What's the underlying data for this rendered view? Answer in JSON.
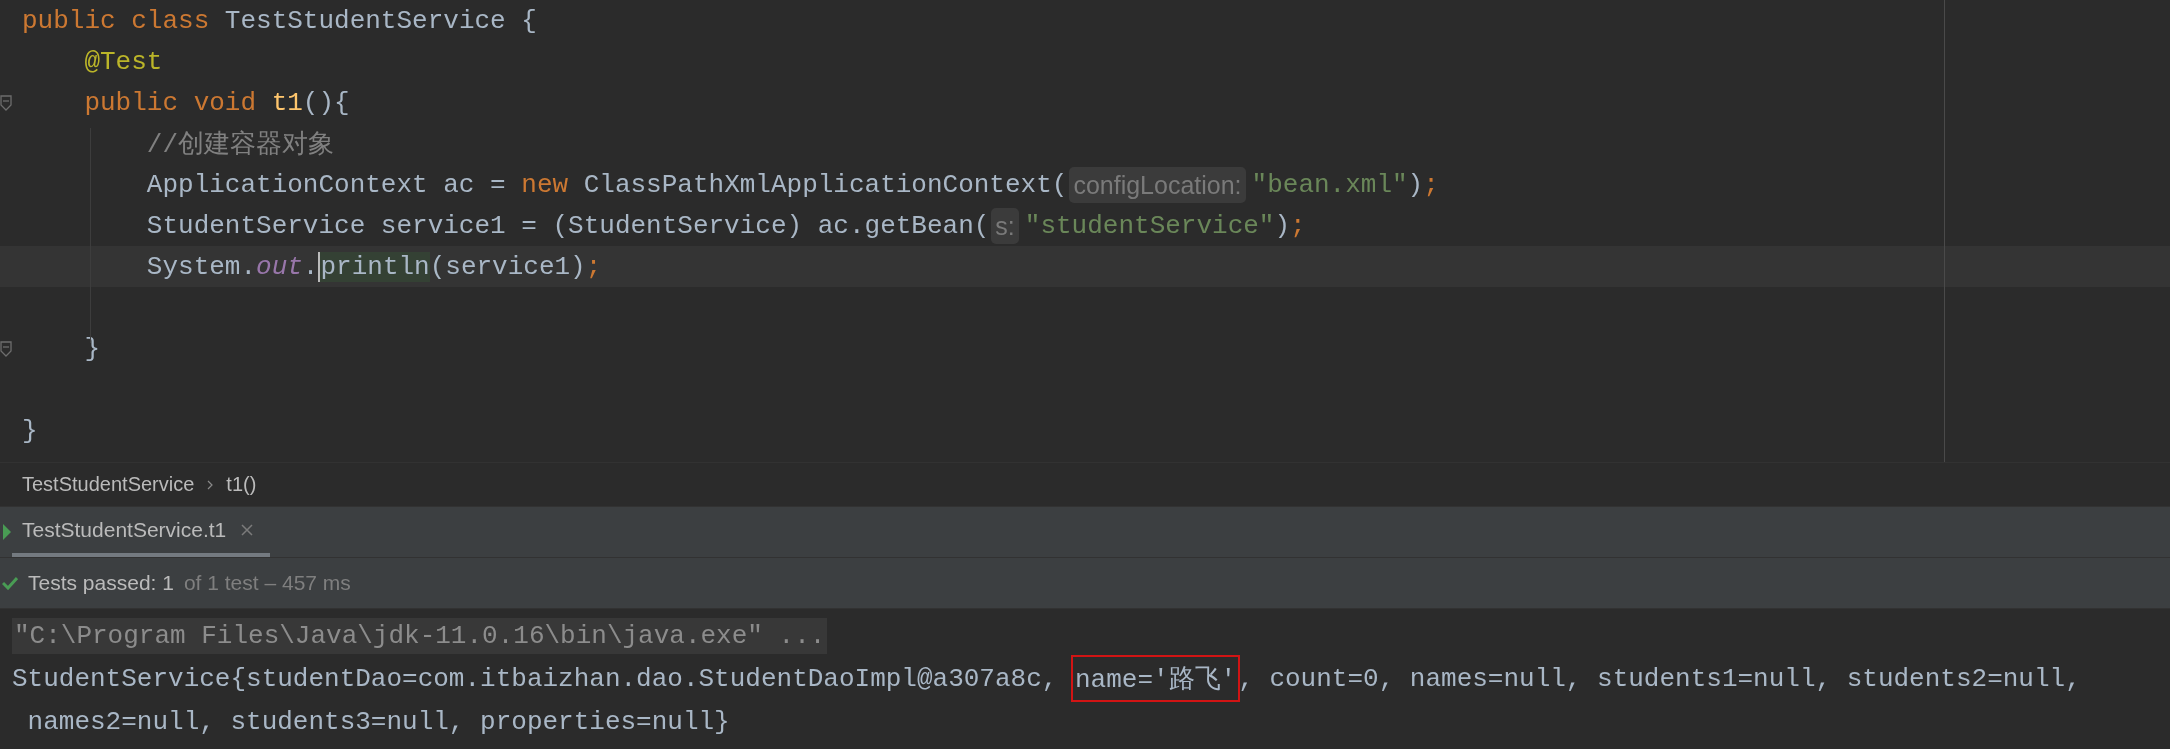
{
  "editor": {
    "lines": [
      {
        "kind": "code",
        "tokens": [
          {
            "kind": "keyword",
            "text": "public class "
          },
          {
            "kind": "plain",
            "text": "TestStudentService {"
          }
        ]
      },
      {
        "kind": "code",
        "tokens": [
          {
            "kind": "annotation",
            "text": "    @Test"
          }
        ]
      },
      {
        "kind": "code",
        "fold": true,
        "tokens": [
          {
            "kind": "keyword",
            "text": "    public void "
          },
          {
            "kind": "method",
            "text": "t1"
          },
          {
            "kind": "plain",
            "text": "(){"
          }
        ]
      },
      {
        "kind": "code",
        "tokens": [
          {
            "kind": "comment",
            "text": "        //创建容器对象"
          }
        ]
      },
      {
        "kind": "code",
        "tokens": [
          {
            "kind": "plain",
            "text": "        ApplicationContext ac = "
          },
          {
            "kind": "keyword",
            "text": "new "
          },
          {
            "kind": "plain",
            "text": "ClassPathXmlApplicationContext("
          },
          {
            "kind": "hint",
            "text": "configLocation:"
          },
          {
            "kind": "string",
            "text": "\"bean.xml\""
          },
          {
            "kind": "plain",
            "text": ")"
          },
          {
            "kind": "keyword",
            "text": ";"
          }
        ]
      },
      {
        "kind": "code",
        "tokens": [
          {
            "kind": "plain",
            "text": "        StudentService service1 = (StudentService) ac.getBean("
          },
          {
            "kind": "hint",
            "text": "s:"
          },
          {
            "kind": "string",
            "text": "\"studentService\""
          },
          {
            "kind": "plain",
            "text": ")"
          },
          {
            "kind": "keyword",
            "text": ";"
          }
        ]
      },
      {
        "kind": "code",
        "current": true,
        "tokens": [
          {
            "kind": "plain",
            "text": "        System."
          },
          {
            "kind": "static",
            "text": "out"
          },
          {
            "kind": "plain",
            "text": "."
          },
          {
            "kind": "usage",
            "text": "println"
          },
          {
            "kind": "plain",
            "text": "(service1)"
          },
          {
            "kind": "keyword",
            "text": ";"
          }
        ]
      },
      {
        "kind": "blank"
      },
      {
        "kind": "code",
        "fold": true,
        "tokens": [
          {
            "kind": "plain",
            "text": "    }"
          }
        ]
      },
      {
        "kind": "blank"
      },
      {
        "kind": "code",
        "tokens": [
          {
            "kind": "plain",
            "text": "}"
          }
        ]
      }
    ]
  },
  "breadcrumbs": [
    "TestStudentService",
    "t1()"
  ],
  "run_tab": {
    "label": "TestStudentService.t1",
    "selected": true
  },
  "test_status": {
    "summary": "Tests passed: 1",
    "detail": "of 1 test – 457 ms"
  },
  "console": {
    "lines": [
      {
        "kind": "command",
        "segments": [
          {
            "text": "\"C:\\Program Files\\Java\\jdk-11.0.16\\bin\\java.exe\" ...",
            "boxed": false
          }
        ]
      },
      {
        "kind": "output",
        "segments": [
          {
            "text": "StudentService{studentDao=com.itbaizhan.dao.StudentDaoImpl@a307a8c, ",
            "boxed": false
          },
          {
            "text": "name='路飞'",
            "boxed": true
          },
          {
            "text": ", count=0, names=null, students1=null, students2=null,",
            "boxed": false
          }
        ]
      },
      {
        "kind": "output",
        "segments": [
          {
            "text": " names2=null, students3=null, properties=null}",
            "boxed": false
          }
        ]
      }
    ]
  }
}
